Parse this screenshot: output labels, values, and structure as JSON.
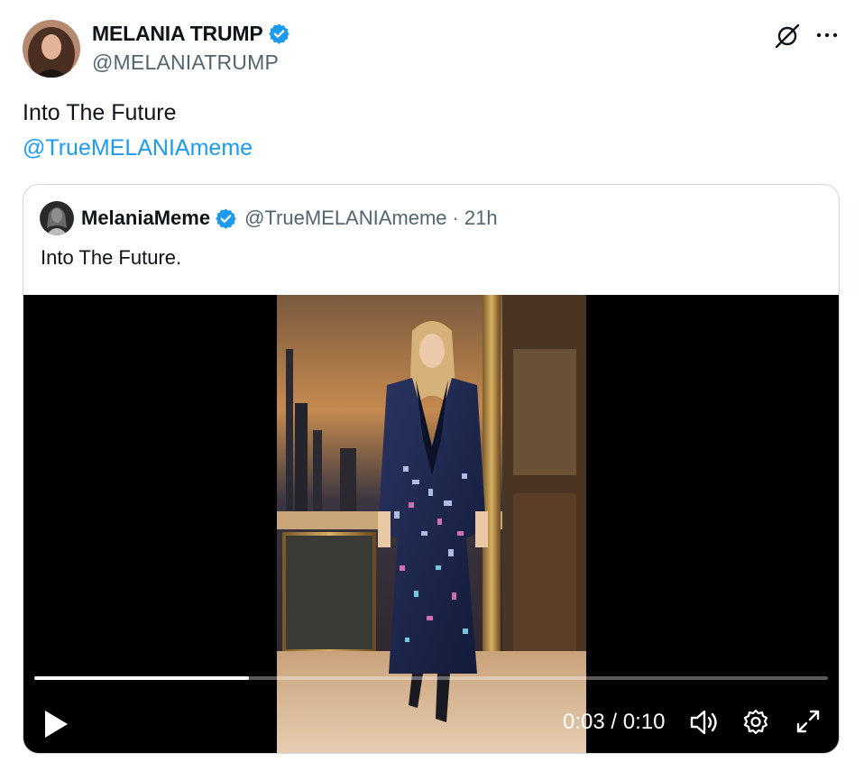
{
  "tweet": {
    "author": {
      "display_name": "MELANIA TRUMP",
      "handle": "@MELANIATRUMP",
      "verified": true
    },
    "text": "Into The Future",
    "mention": "@TrueMELANIAmeme",
    "icons": {
      "grok": "grok-slash-icon",
      "more": "more-options-icon"
    }
  },
  "quote": {
    "author": {
      "display_name": "MelaniaMeme",
      "handle": "@TrueMELANIAmeme",
      "verified": true
    },
    "separator": "·",
    "time": "21h",
    "text": "Into The Future."
  },
  "video": {
    "current_time": "0:03",
    "duration": "0:10",
    "time_label": "0:03 / 0:10",
    "progress": 0.27,
    "controls": [
      "play-icon",
      "volume-icon",
      "settings-icon",
      "fullscreen-icon"
    ]
  },
  "colors": {
    "link": "#1d9bf0",
    "verified": "#1d9bf0",
    "secondary_text": "#536471",
    "border": "#cfd9de",
    "video_bg": "#000000"
  }
}
